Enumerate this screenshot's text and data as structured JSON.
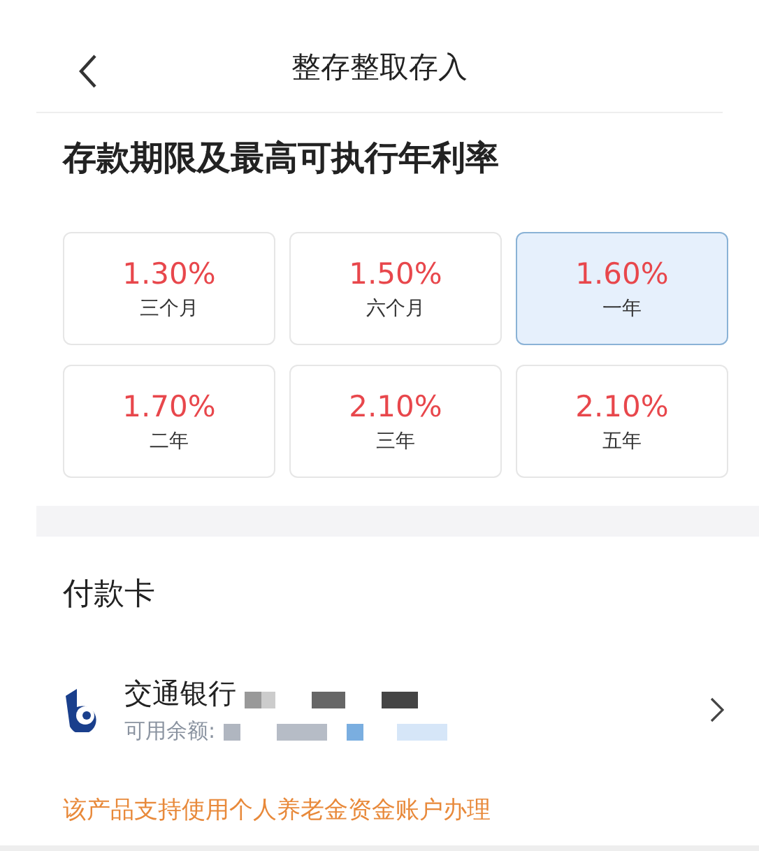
{
  "header": {
    "title": "整存整取存入"
  },
  "term_section": {
    "title": "存款期限及最高可执行年利率",
    "options": [
      {
        "rate": "1.30%",
        "term": "三个月",
        "selected": false
      },
      {
        "rate": "1.50%",
        "term": "六个月",
        "selected": false
      },
      {
        "rate": "1.60%",
        "term": "一年",
        "selected": true
      },
      {
        "rate": "1.70%",
        "term": "二年",
        "selected": false
      },
      {
        "rate": "2.10%",
        "term": "三年",
        "selected": false
      },
      {
        "rate": "2.10%",
        "term": "五年",
        "selected": false
      }
    ]
  },
  "payment_section": {
    "title": "付款卡",
    "card": {
      "bank_name": "交通银行",
      "balance_label": "可用余额:"
    },
    "note": "该产品支持使用个人养老金资金账户办理"
  }
}
